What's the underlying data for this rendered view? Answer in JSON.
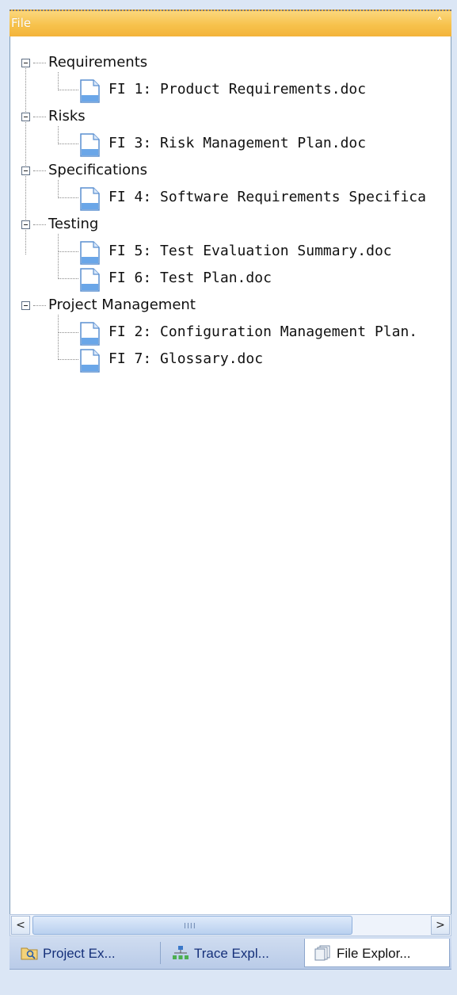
{
  "panel": {
    "title": "File",
    "collapse_icon": "double-chevron-up-icon"
  },
  "tree": {
    "groups": [
      {
        "label": "Requirements",
        "files": [
          "FI 1: Product Requirements.doc"
        ]
      },
      {
        "label": "Risks",
        "files": [
          "FI 3: Risk Management Plan.doc"
        ]
      },
      {
        "label": "Specifications",
        "files": [
          "FI 4: Software Requirements Specifica"
        ]
      },
      {
        "label": "Testing",
        "files": [
          "FI 5: Test Evaluation Summary.doc",
          "FI 6: Test Plan.doc"
        ]
      },
      {
        "label": "Project Management",
        "files": [
          "FI 2: Configuration Management Plan.",
          "FI 7: Glossary.doc"
        ]
      }
    ]
  },
  "scrollbar": {
    "left_arrow": "<",
    "right_arrow": ">",
    "thumb_grip": "IIII"
  },
  "tabs": [
    {
      "label": "Project Ex...",
      "icon": "project-explorer-icon",
      "active": false
    },
    {
      "label": "Trace Expl...",
      "icon": "trace-explorer-icon",
      "active": false
    },
    {
      "label": "File Explor...",
      "icon": "file-explorer-icon",
      "active": true
    }
  ],
  "colors": {
    "header_accent": "#f7c24c",
    "selection_tab_bg": "#ffffff",
    "tab_text": "#15307a"
  }
}
